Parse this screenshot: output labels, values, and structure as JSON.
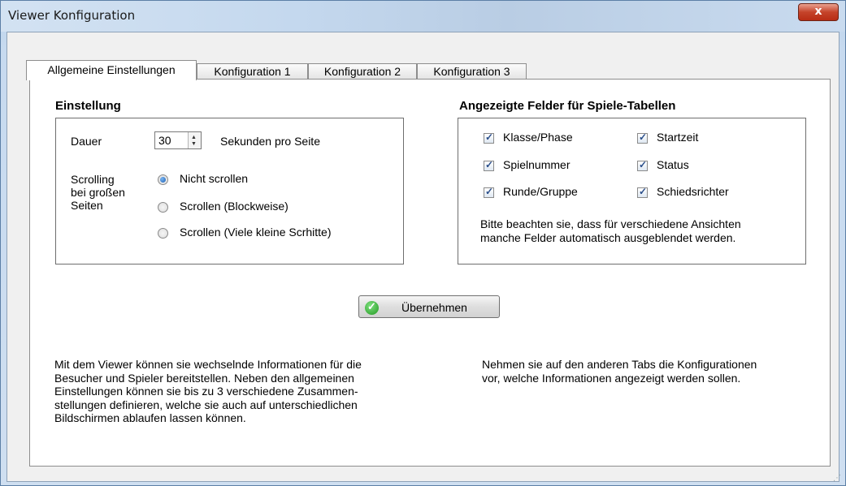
{
  "window": {
    "title": "Viewer Konfiguration",
    "close_label": "x"
  },
  "tabs": [
    {
      "label": "Allgemeine Einstellungen",
      "active": true
    },
    {
      "label": "Konfiguration 1",
      "active": false
    },
    {
      "label": "Konfiguration 2",
      "active": false
    },
    {
      "label": "Konfiguration 3",
      "active": false
    }
  ],
  "settings": {
    "title": "Einstellung",
    "duration_label": "Dauer",
    "duration_value": "30",
    "duration_unit": "Sekunden pro Seite",
    "scrolling_label": [
      "Scrolling",
      "bei großen",
      "Seiten"
    ],
    "scroll_options": [
      {
        "label": "Nicht scrollen",
        "checked": true
      },
      {
        "label": "Scrollen (Blockweise)",
        "checked": false
      },
      {
        "label": "Scrollen (Viele kleine Scrhitte)",
        "checked": false
      }
    ]
  },
  "fields": {
    "title": "Angezeigte Felder für Spiele-Tabellen",
    "items": [
      {
        "label": "Klasse/Phase",
        "checked": true
      },
      {
        "label": "Startzeit",
        "checked": true
      },
      {
        "label": "Spielnummer",
        "checked": true
      },
      {
        "label": "Status",
        "checked": true
      },
      {
        "label": "Runde/Gruppe",
        "checked": true
      },
      {
        "label": "Schiedsrichter",
        "checked": true
      }
    ],
    "note": [
      "Bitte beachten sie, dass für verschiedene Ansichten",
      "manche Felder automatisch ausgeblendet werden."
    ]
  },
  "apply_label": "Übernehmen",
  "info_left": [
    "Mit dem Viewer können sie wechselnde Informationen für die",
    "Besucher und Spieler bereitstellen. Neben den allgemeinen",
    "Einstellungen können sie bis zu 3 verschiedene Zusammen-",
    "stellungen definieren, welche sie auch auf unterschiedlichen",
    "Bildschirmen ablaufen lassen können."
  ],
  "info_right": [
    "Nehmen sie auf den anderen Tabs die Konfigurationen",
    "vor, welche Informationen angezeigt werden sollen."
  ]
}
